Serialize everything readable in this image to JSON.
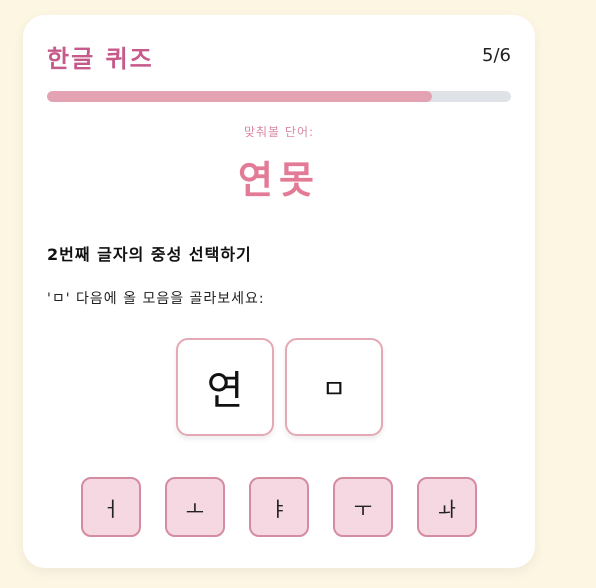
{
  "quiz": {
    "title": "한글 퀴즈",
    "counter": "5/6",
    "progress": 0.83
  },
  "word": {
    "label": "맞춰볼 단어:",
    "text": "연못"
  },
  "instruction": "2번째 글자의 중성 선택하기",
  "hint": "'ㅁ' 다음에 올 모음을 골라보세요:",
  "syllables": [
    {
      "text": "연",
      "state": "filled"
    },
    {
      "text": "ㅁ",
      "state": "current"
    }
  ],
  "options": [
    "ㅓ",
    "ㅗ",
    "ㅑ",
    "ㅜ",
    "ㅘ"
  ],
  "colors": {
    "accent": "#c65a8a",
    "word": "#e37b97",
    "progress_fill": "#e3a3b3",
    "option_bg": "#f6d8e2"
  }
}
